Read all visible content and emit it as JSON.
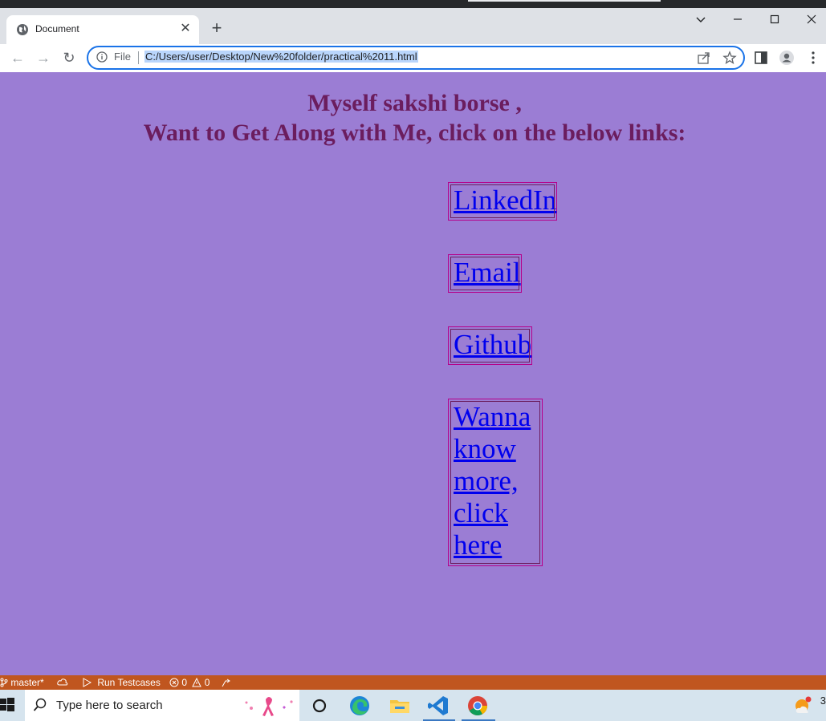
{
  "browser": {
    "tab": {
      "title": "Document",
      "close": "✕"
    },
    "new_tab": "+",
    "window_controls": {
      "minimize": "—",
      "maximize": "☐",
      "close": "✕",
      "tab_search": "⌄"
    },
    "omnibox": {
      "scheme_label": "File",
      "url": "C:/Users/user/Desktop/New%20folder/practical%2011.html"
    },
    "nav": {
      "back": "←",
      "forward": "→",
      "reload": "↻"
    }
  },
  "page": {
    "heading_line1": "Myself sakshi borse ,",
    "heading_line2": "Want to Get Along with Me, click on the below links:",
    "links": [
      "LinkedIn",
      "Email",
      "Github",
      "Wanna know more, click here"
    ],
    "colors": {
      "background": "#9b7dd4",
      "heading": "#6b1d5e",
      "link": "#0000ee",
      "border": "#b5008a"
    }
  },
  "statusbar": {
    "branch": "master*",
    "run": "Run Testcases",
    "errors": "0",
    "warnings": "0",
    "color": "#c0561f"
  },
  "taskbar": {
    "search_placeholder": "Type here to search",
    "tray_text": "3"
  }
}
